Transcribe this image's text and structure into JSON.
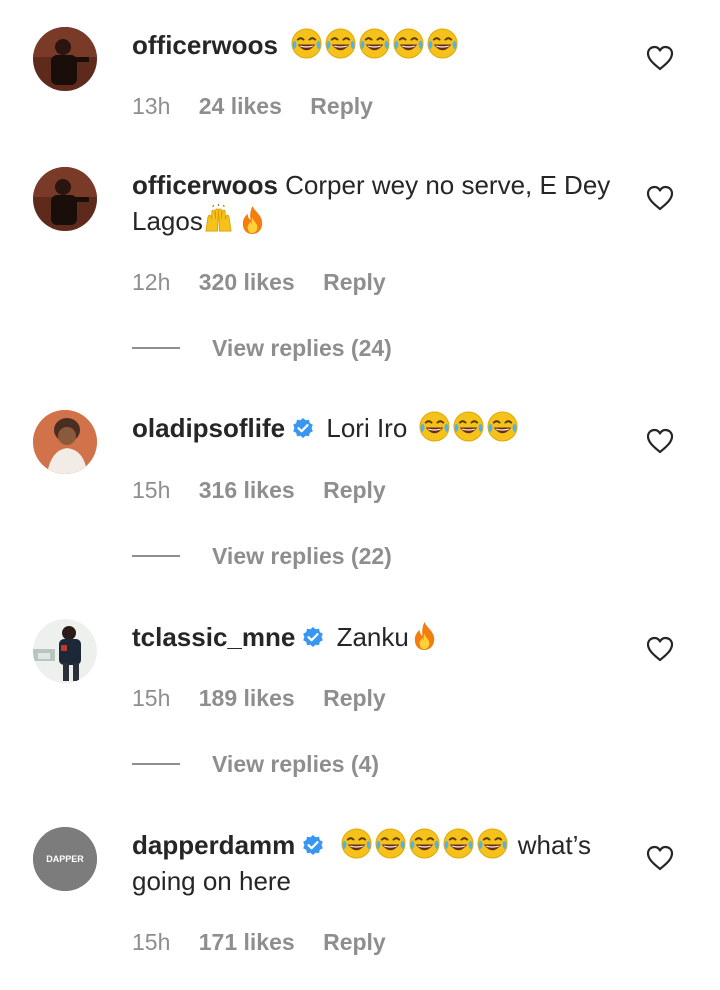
{
  "comments": [
    {
      "username": "officerwoos",
      "verified": false,
      "emojis_before": [
        "face-with-tears-of-joy-icon",
        "face-with-tears-of-joy-icon",
        "face-with-tears-of-joy-icon",
        "face-with-tears-of-joy-icon",
        "face-with-tears-of-joy-icon"
      ],
      "text": "",
      "time": "13h",
      "likes": "24 likes",
      "reply": "Reply"
    },
    {
      "username": "officerwoos",
      "verified": false,
      "text": "Corper wey no serve, E Dey Lagos",
      "emojis_after": [
        "raising-hands-icon",
        "fire-icon"
      ],
      "time": "12h",
      "likes": "320 likes",
      "reply": "Reply",
      "view_replies": "View replies (24)"
    },
    {
      "username": "oladipsoflife",
      "verified": true,
      "text": "Lori Iro",
      "emojis_after": [
        "face-with-tears-of-joy-icon",
        "face-with-tears-of-joy-icon",
        "face-with-tears-of-joy-icon"
      ],
      "time": "15h",
      "likes": "316 likes",
      "reply": "Reply",
      "view_replies": "View replies (22)"
    },
    {
      "username": "tclassic_mne",
      "verified": true,
      "text": "Zanku",
      "emojis_after": [
        "fire-icon"
      ],
      "time": "15h",
      "likes": "189 likes",
      "reply": "Reply",
      "view_replies": "View replies (4)"
    },
    {
      "username": "dapperdamm",
      "verified": true,
      "emojis_before": [
        "face-with-tears-of-joy-icon",
        "face-with-tears-of-joy-icon",
        "face-with-tears-of-joy-icon",
        "face-with-tears-of-joy-icon",
        "face-with-tears-of-joy-icon"
      ],
      "text": "what’s going on here",
      "avatar_text": "DAPPER",
      "time": "15h",
      "likes": "171 likes",
      "reply": "Reply"
    }
  ],
  "colors": {
    "text": "#262626",
    "muted": "#8e8e8e",
    "verified": "#3897f0"
  }
}
